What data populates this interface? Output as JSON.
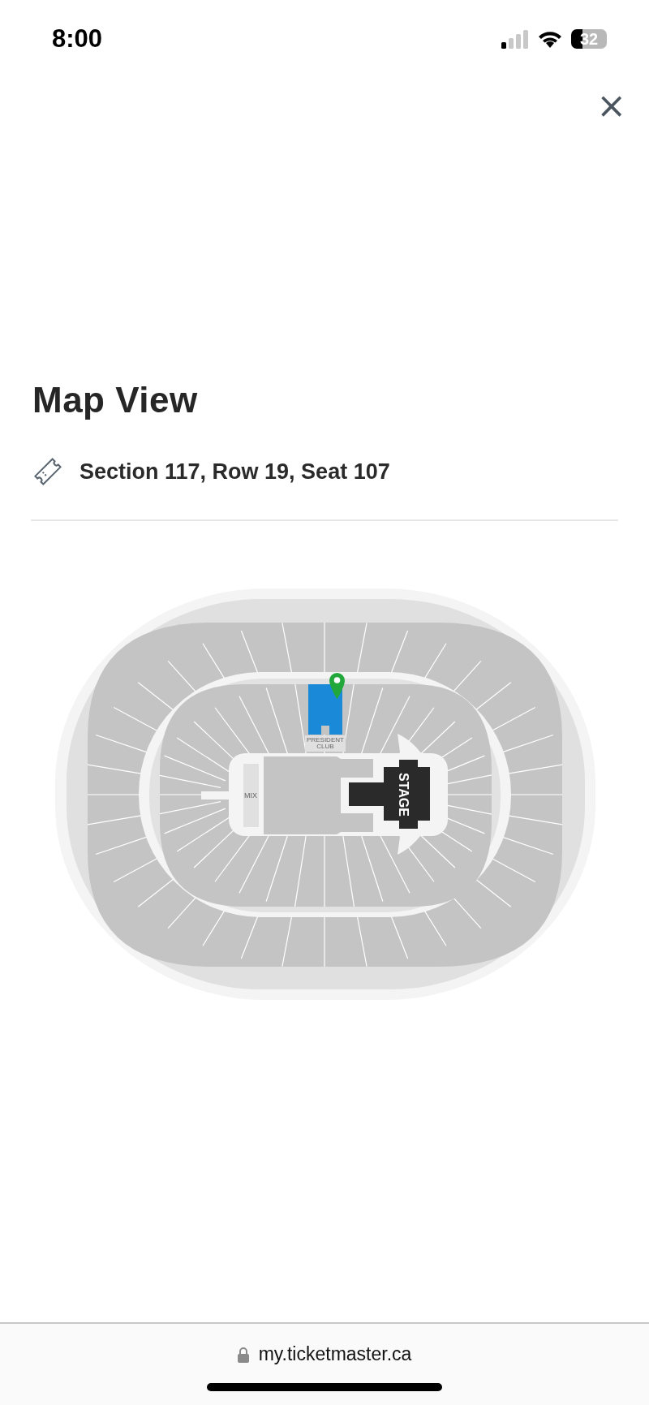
{
  "status_bar": {
    "time": "8:00",
    "battery": "32"
  },
  "close_button": {
    "label": "×"
  },
  "title": "Map View",
  "seat": {
    "text": "Section 117, Row 19, Seat 107"
  },
  "map": {
    "club_label": "PRESIDENT CLUB",
    "mix_label": "MIX",
    "stage_label": "STAGE",
    "section_selected": true
  },
  "address_bar": {
    "url": "my.ticketmaster.ca"
  }
}
